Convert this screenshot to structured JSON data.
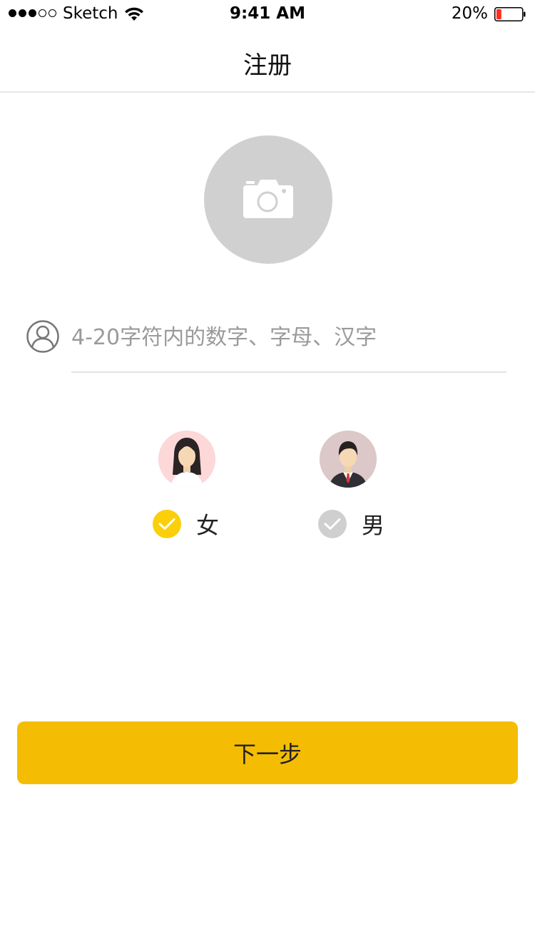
{
  "status_bar": {
    "carrier": "Sketch",
    "time": "9:41 AM",
    "battery_percent": "20%",
    "battery_level": 0.2,
    "battery_color": "#ff2d20",
    "signal_bars_filled": 3,
    "signal_bars_total": 5
  },
  "nav": {
    "title": "注册"
  },
  "avatar_upload": {
    "icon": "camera-icon",
    "background": "#d0d0d0"
  },
  "nickname": {
    "icon": "user-icon",
    "value": "",
    "placeholder": "4-20字符内的数字、字母、汉字"
  },
  "gender": {
    "options": [
      {
        "label": "女",
        "icon": "female-avatar-icon",
        "checked": true
      },
      {
        "label": "男",
        "icon": "male-avatar-icon",
        "checked": false
      }
    ]
  },
  "next_button": {
    "label": "下一步",
    "color": "#f4bd03"
  },
  "colors": {
    "accent": "#f4bd03",
    "check_active": "#fbcf0a",
    "check_inactive": "#cfcfcf"
  }
}
